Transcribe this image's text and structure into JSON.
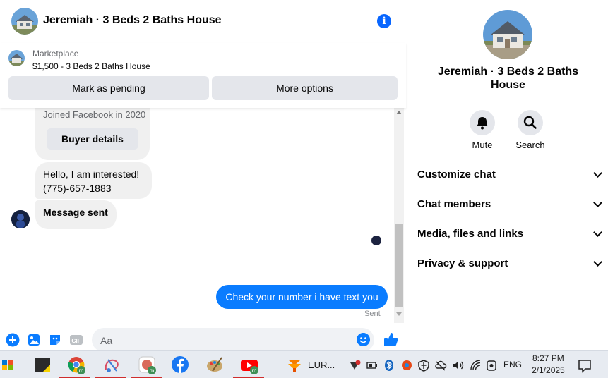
{
  "chat": {
    "header_title": "Jeremiah · 3 Beds 2 Baths House",
    "marketplace_category": "Marketplace",
    "listing": "$1,500 - 3 Beds 2 Baths House",
    "buttons": {
      "mark_pending": "Mark as pending",
      "more_options": "More options"
    },
    "joined_text": "Joined Facebook in 2020",
    "buyer_details": "Buyer details",
    "messages": {
      "interest_line1": "Hello, I am interested!",
      "interest_line2": "(775)-657-1883",
      "message_sent": "Message sent",
      "outgoing": "Check your number i have text you",
      "status": "Sent"
    },
    "composer_placeholder": "Aa",
    "accent_color": "#0a7cff"
  },
  "details": {
    "name": "Jeremiah · 3 Beds 2 Baths House",
    "actions": {
      "mute": "Mute",
      "search": "Search"
    },
    "sections": [
      "Customize chat",
      "Chat members",
      "Media, files and links",
      "Privacy & support"
    ]
  },
  "taskbar": {
    "eur_label": "EUR...",
    "language": "ENG",
    "time": "8:27 PM",
    "date": "2/1/2025"
  }
}
